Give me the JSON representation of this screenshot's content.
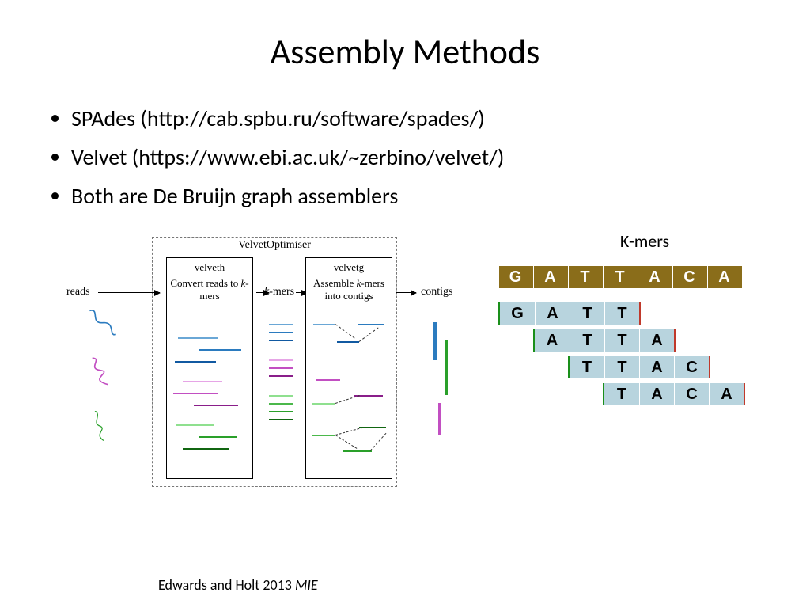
{
  "title": "Assembly Methods",
  "bullets": [
    "SPAdes (http://cab.spbu.ru/software/spades/)",
    "Velvet (https://www.ebi.ac.uk/~zerbino/velvet/)",
    "Both are De Bruijn graph assemblers"
  ],
  "velvet": {
    "optimiser": "VelvetOptimiser",
    "velveth_title": "velveth",
    "velveth_text": "Convert reads to k-mers",
    "velvetg_title": "velvetg",
    "velvetg_text": "Assemble k-mers into contigs",
    "reads_label": "reads",
    "kmers_label": "k-mers",
    "contigs_label": "contigs"
  },
  "kmers": {
    "title": "K-mers",
    "sequence": [
      "G",
      "A",
      "T",
      "T",
      "A",
      "C",
      "A"
    ],
    "rows": [
      {
        "offset": 0,
        "kmer": [
          "G",
          "A",
          "T",
          "T"
        ]
      },
      {
        "offset": 1,
        "kmer": [
          "A",
          "T",
          "T",
          "A"
        ]
      },
      {
        "offset": 2,
        "kmer": [
          "T",
          "T",
          "A",
          "C"
        ]
      },
      {
        "offset": 3,
        "kmer": [
          "T",
          "A",
          "C",
          "A"
        ]
      }
    ]
  },
  "citation": {
    "authors": "Edwards and Holt 2013 ",
    "work": "MIE"
  },
  "colors": {
    "read1": "#2b7bbf",
    "read2": "#c24fc2",
    "read3": "#2aa02a",
    "kmer_bg": "#b8d4de",
    "header_bg": "#8a6d1a"
  }
}
